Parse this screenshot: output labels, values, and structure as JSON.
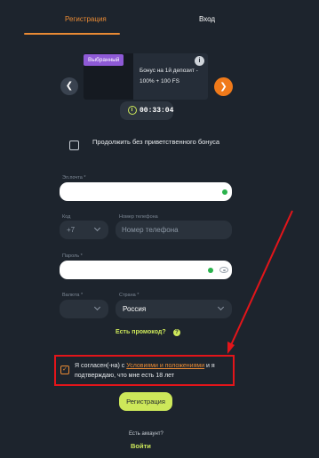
{
  "tabs": [
    {
      "label": "Регистрация",
      "active": true
    },
    {
      "label": "Вход",
      "active": false
    }
  ],
  "bonus": {
    "badge": "Выбранный",
    "text": "Бонус на 1й депозит - 100% + 100 FS",
    "info_icon": "i"
  },
  "timer": {
    "value": "00:33:04",
    "icon": "stopwatch-icon"
  },
  "no_bonus": {
    "label": "Продолжить без приветственного бонуса",
    "checked": false
  },
  "fields": {
    "email": {
      "label": "Эл.почта *",
      "value": ""
    },
    "code": {
      "label": "Код",
      "value": "+7"
    },
    "phone": {
      "label": "Номер телефона",
      "placeholder": "Номер телефона"
    },
    "password": {
      "label": "Пароль *",
      "value": ""
    },
    "currency": {
      "label": "Валюта *",
      "value": ""
    },
    "country": {
      "label": "Страна *",
      "value": "Россия"
    }
  },
  "promo": {
    "label": "Есть промокод?",
    "icon": "?"
  },
  "terms": {
    "check": "✓",
    "text_before": "Я согласен(-на) с ",
    "link": "Условиями и положениями",
    "text_after": " и я подтверждаю, что мне есть 18 лет",
    "checked": true
  },
  "register_button": "Регистрация",
  "have_account": "Есть аккаунт?",
  "login_link": "Войти",
  "colors": {
    "accent": "#e98a34",
    "lime": "#cde85a",
    "background": "#1d242d",
    "annotation": "#e3151a"
  }
}
